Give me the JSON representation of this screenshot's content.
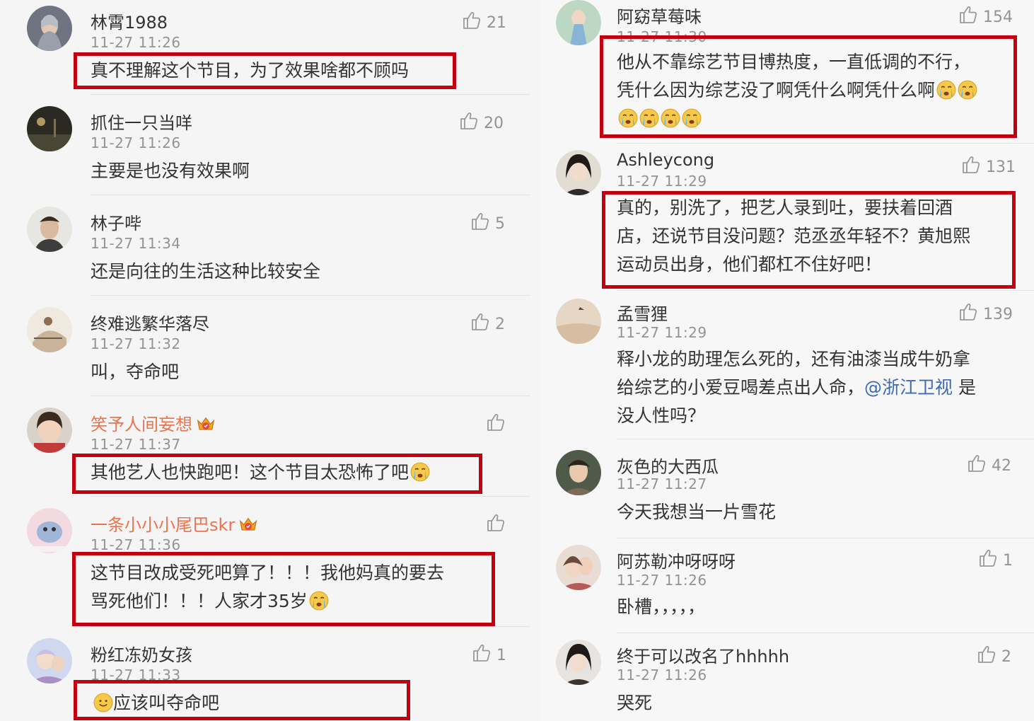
{
  "left_comments": [
    {
      "user": "林霄1988",
      "time": "11-27 11:26",
      "likes": "21",
      "text": "真不理解这个节目，为了效果啥都不顾吗",
      "vip": false
    },
    {
      "user": "抓住一只当咩",
      "time": "11-27 11:26",
      "likes": "20",
      "text": "主要是也没有效果啊",
      "vip": false
    },
    {
      "user": "林子哔",
      "time": "11-27 11:34",
      "likes": "5",
      "text": "还是向往的生活这种比较安全",
      "vip": false
    },
    {
      "user": "终难逃繁华落尽",
      "time": "11-27 11:32",
      "likes": "2",
      "text": "叫，夺命吧",
      "vip": false
    },
    {
      "user": "笑予人间妄想",
      "time": "11-27 11:37",
      "likes": "",
      "text": "其他艺人也快跑吧！这个节目太恐怖了吧",
      "vip": true,
      "emoji": "crying-emoji"
    },
    {
      "user": "一条小小小尾巴skr",
      "time": "11-27 11:36",
      "likes": "",
      "line1": "这节目改成受死吧算了！！！我他妈真的要去",
      "line2": "骂死他们！！！人家才35岁",
      "vip": true,
      "emoji": "crying-emoji"
    },
    {
      "user": "粉红冻奶女孩",
      "time": "11-27 11:33",
      "likes": "1",
      "text": "应该叫夺命吧",
      "vip": false,
      "emoji": "smile-emoji"
    }
  ],
  "right_comments": [
    {
      "user": "阿窈草莓味",
      "time": "11-27 11:30",
      "likes": "154",
      "line1": "他从不靠综艺节目博热度，一直低调的不行，",
      "line2": "凭什么因为综艺没了啊凭什么啊凭什么啊",
      "emoji": "crying-emoji"
    },
    {
      "user": "Ashleycong",
      "time": "11-27 11:29",
      "likes": "131",
      "line1": "真的，别洗了，把艺人录到吐，要扶着回酒",
      "line2": "店，还说节目没问题？范丞丞年轻不？黄旭熙",
      "line3": "运动员出身，他们都杠不住好吧！"
    },
    {
      "user": "孟雪狸",
      "time": "11-27 11:29",
      "likes": "139",
      "line1": "释小龙的助理怎么死的，还有油漆当成牛奶拿",
      "line2a": "给综艺的小爱豆喝差点出人命，",
      "mention": "@浙江卫视",
      "line2b": " 是",
      "line3": "没人性吗？"
    },
    {
      "user": "灰色的大西瓜",
      "time": "11-27 11:27",
      "likes": "42",
      "text": "今天我想当一片雪花"
    },
    {
      "user": "阿苏勒冲呀呀呀",
      "time": "11-27 11:26",
      "likes": "1",
      "text": "卧槽，，，，，"
    },
    {
      "user": "终于可以改名了hhhhh",
      "time": "11-27 11:26",
      "likes": "2",
      "text": "哭死"
    }
  ],
  "colors": {
    "highlight_border": "#c3000f",
    "vip_name": "#eb7350",
    "mention": "#3e6bb5",
    "muted": "#939393"
  }
}
